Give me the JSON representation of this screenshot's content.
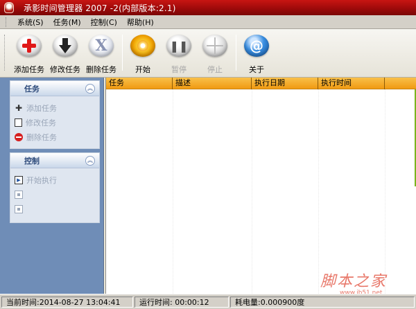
{
  "window": {
    "title": "承影时间管理器 2007 -2(内部版本:2.1)"
  },
  "menu": {
    "items": [
      "系统(S)",
      "任务(M)",
      "控制(C)",
      "帮助(H)"
    ]
  },
  "toolbar": {
    "buttons": [
      {
        "label": "添加任务",
        "icon": "add-icon",
        "enabled": true
      },
      {
        "label": "修改任务",
        "icon": "edit-arrow-icon",
        "enabled": true
      },
      {
        "label": "删除任务",
        "icon": "delete-x-icon",
        "enabled": true
      },
      {
        "label": "开始",
        "icon": "start-disc-icon",
        "enabled": true
      },
      {
        "label": "暂停",
        "icon": "pause-icon",
        "enabled": false
      },
      {
        "label": "停止",
        "icon": "stop-icon",
        "enabled": false
      },
      {
        "label": "关于",
        "icon": "about-at-icon",
        "enabled": true
      }
    ]
  },
  "sidebar": {
    "task_group": {
      "title": "任务",
      "items": [
        {
          "label": "添加任务",
          "icon": "plus-icon"
        },
        {
          "label": "修改任务",
          "icon": "edit-icon"
        },
        {
          "label": "删除任务",
          "icon": "delete-icon"
        }
      ]
    },
    "control_group": {
      "title": "控制",
      "items": [
        {
          "label": "开始执行",
          "icon": "play-icon"
        }
      ]
    }
  },
  "tasklist": {
    "columns": [
      "任务",
      "描述",
      "执行日期",
      "执行时间"
    ],
    "rows": []
  },
  "watermark": {
    "main": "脚本之家",
    "sub": "www.jb51.net"
  },
  "statusbar": {
    "current_time": "当前时间:2014-08-27 13:04:41",
    "run_time": "运行时间: 00:00:12",
    "power": "耗电量:0.000900度"
  },
  "colors": {
    "titlebar": "#c81512",
    "list_header": "#f09a12",
    "sidebar_bg": "#6f8db7"
  }
}
